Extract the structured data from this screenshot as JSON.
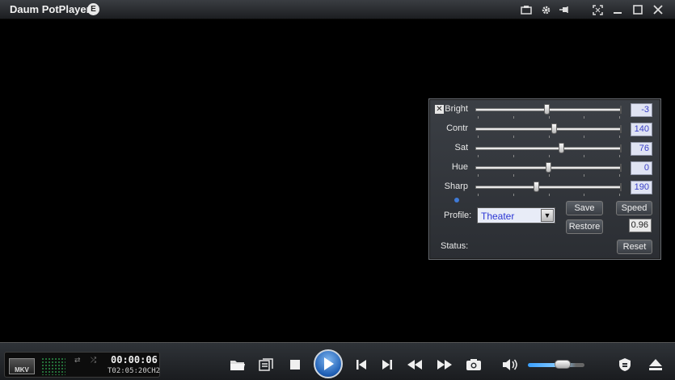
{
  "window": {
    "title": "Daum PotPlayer",
    "edition_badge": "E",
    "title_icons": [
      "skin-icon",
      "gear-icon",
      "pin-icon",
      "fullscreen-icon",
      "minimize-icon",
      "maximize-icon",
      "close-icon"
    ]
  },
  "adjust_panel": {
    "rows": [
      {
        "label": "Bright",
        "value": "-3",
        "level": 0.49
      },
      {
        "label": "Contr",
        "value": "140",
        "level": 0.54
      },
      {
        "label": "Sat",
        "value": "76",
        "level": 0.59
      },
      {
        "label": "Hue",
        "value": "0",
        "level": 0.5
      },
      {
        "label": "Sharp",
        "value": "190",
        "level": 0.42
      }
    ],
    "profile_label": "Profile:",
    "profile_value": "Theater",
    "save_label": "Save",
    "restore_label": "Restore",
    "speed_label": "Speed",
    "speed_value": "0.96",
    "status_label": "Status:",
    "reset_label": "Reset"
  },
  "status_display": {
    "format_badge": "MKV",
    "time_elapsed": "00:00:06",
    "time_total_prefix": "T",
    "time_total": "02:05:20",
    "channel_prefix": "CH",
    "channel_count": "2"
  },
  "controls": {
    "volume_level": 0.76,
    "icons": [
      "open-folder-icon",
      "playlist-icon",
      "stop-icon",
      "play-icon",
      "previous-icon",
      "next-icon",
      "rewind-icon",
      "fast-forward-icon",
      "screenshot-icon",
      "volume-icon",
      "shield-icon",
      "eject-icon"
    ]
  }
}
